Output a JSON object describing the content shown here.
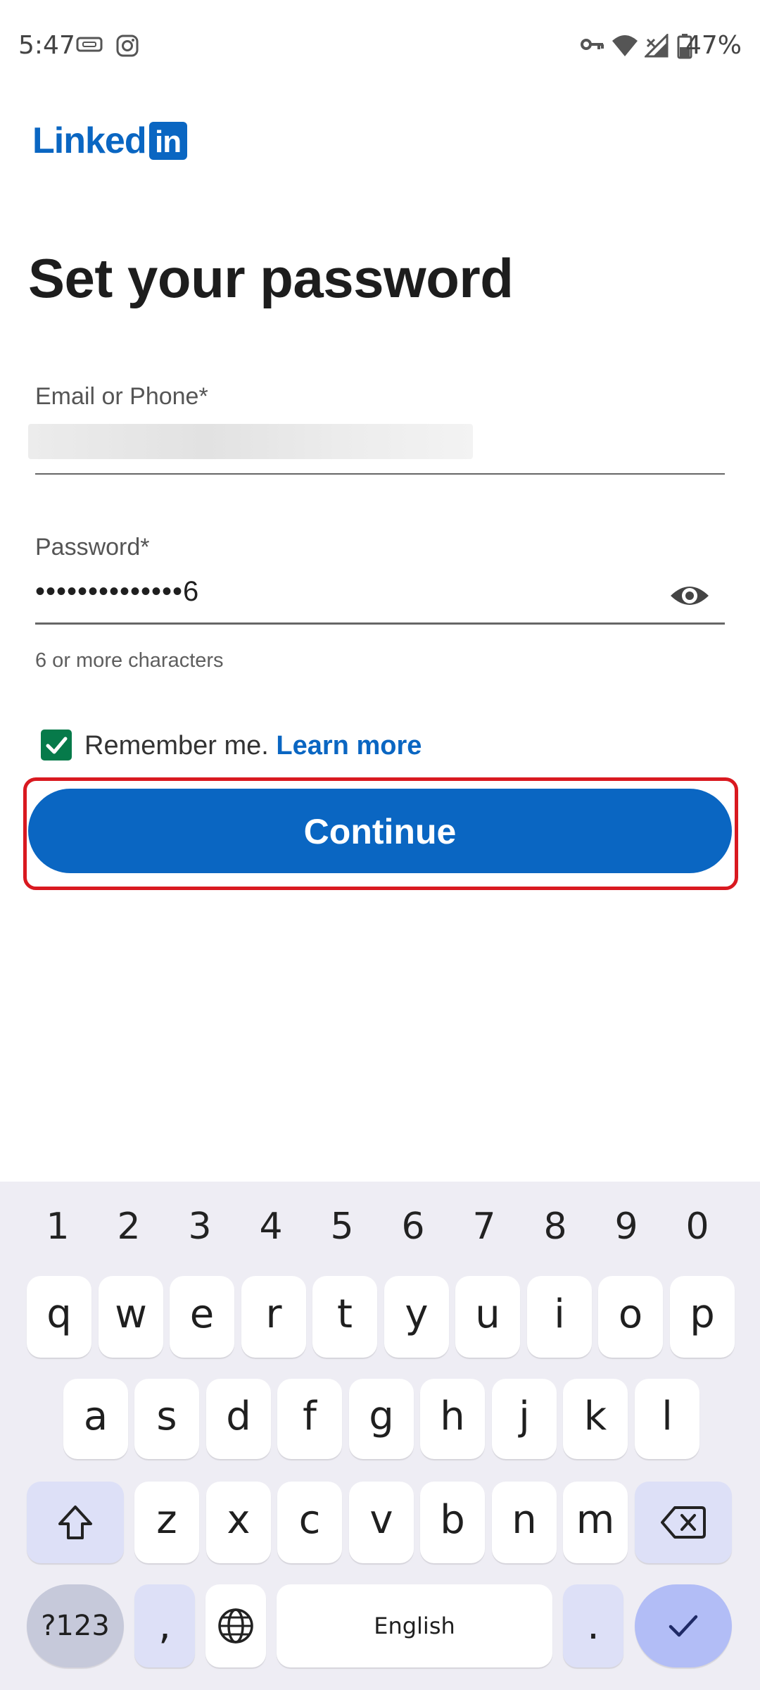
{
  "status_bar": {
    "time": "5:47",
    "battery_percent": "47%",
    "left_icons": [
      "ticket-icon",
      "instagram-icon"
    ],
    "right_icons": [
      "key-icon",
      "wifi-icon",
      "signal-icon",
      "battery-icon"
    ]
  },
  "brand": {
    "wordmark": "Linked",
    "badge": "in",
    "color": "#0a66c2"
  },
  "page": {
    "title": "Set your password"
  },
  "form": {
    "email_label": "Email or Phone*",
    "password_label": "Password*",
    "password_value": "••••••••••••••6",
    "password_helper": "6 or more characters",
    "remember_label": "Remember me.",
    "remember_checked": true,
    "learn_more": "Learn more",
    "continue_label": "Continue"
  },
  "keyboard": {
    "numbers": [
      "1",
      "2",
      "3",
      "4",
      "5",
      "6",
      "7",
      "8",
      "9",
      "0"
    ],
    "row1": [
      "q",
      "w",
      "e",
      "r",
      "t",
      "y",
      "u",
      "i",
      "o",
      "p"
    ],
    "row2": [
      "a",
      "s",
      "d",
      "f",
      "g",
      "h",
      "j",
      "k",
      "l"
    ],
    "row3": [
      "z",
      "x",
      "c",
      "v",
      "b",
      "n",
      "m"
    ],
    "symbols_label": "?123",
    "comma": ",",
    "space_label": "English",
    "period": "."
  },
  "colors": {
    "accent": "#0a66c2",
    "highlight": "#d91920",
    "checkbox": "#067a4a"
  }
}
